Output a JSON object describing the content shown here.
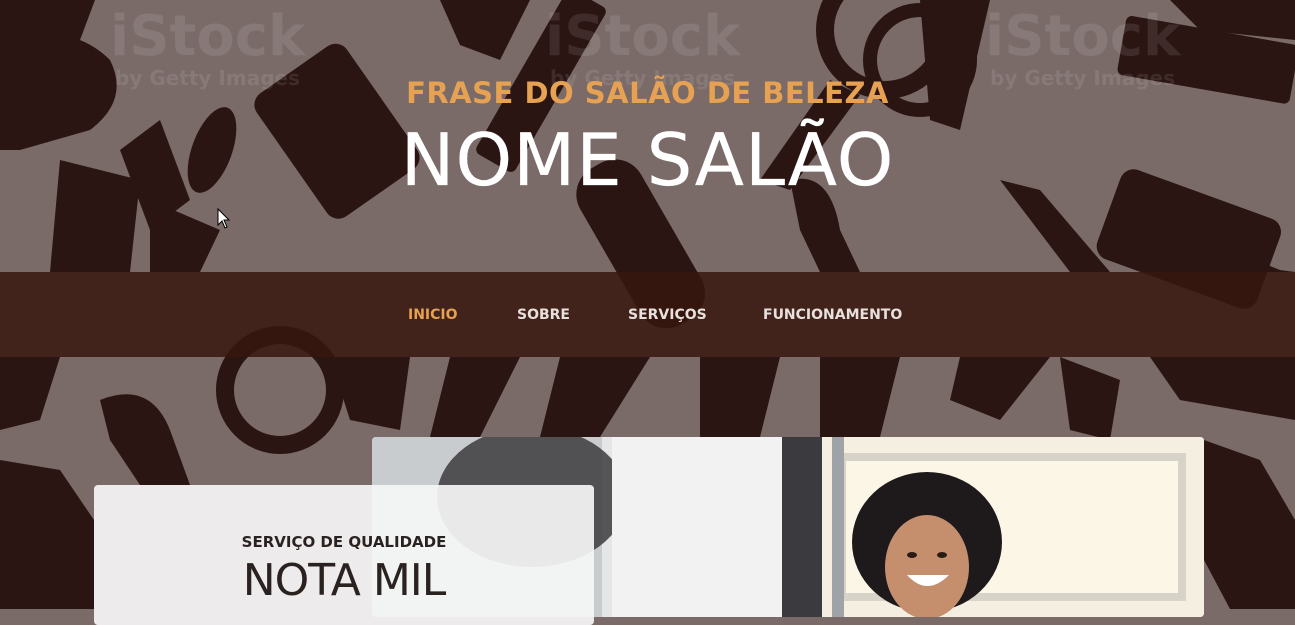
{
  "header": {
    "tagline": "FRASE DO SALÃO DE BELEZA",
    "salon_name": "NOME SALÃO"
  },
  "nav": {
    "items": [
      {
        "label": "INICIO",
        "active": true
      },
      {
        "label": "SOBRE",
        "active": false
      },
      {
        "label": "SERVIÇOS",
        "active": false
      },
      {
        "label": "FUNCIONAMENTO",
        "active": false
      }
    ]
  },
  "card": {
    "subtitle": "SERVIÇO DE QUALIDADE",
    "title": "NOTA MIL"
  },
  "watermark": {
    "brand": "iStock",
    "sub": "by Getty Images"
  },
  "colors": {
    "accent": "#e6a152",
    "background": "#7a6a68",
    "pattern": "#2a1512",
    "nav_bg": "#3a1a10",
    "text_light": "#ffffff"
  },
  "icons": [
    "scissors-icon",
    "comb-icon",
    "razor-blade-icon",
    "hair-dryer-icon",
    "mirror-icon",
    "cursor-icon"
  ]
}
